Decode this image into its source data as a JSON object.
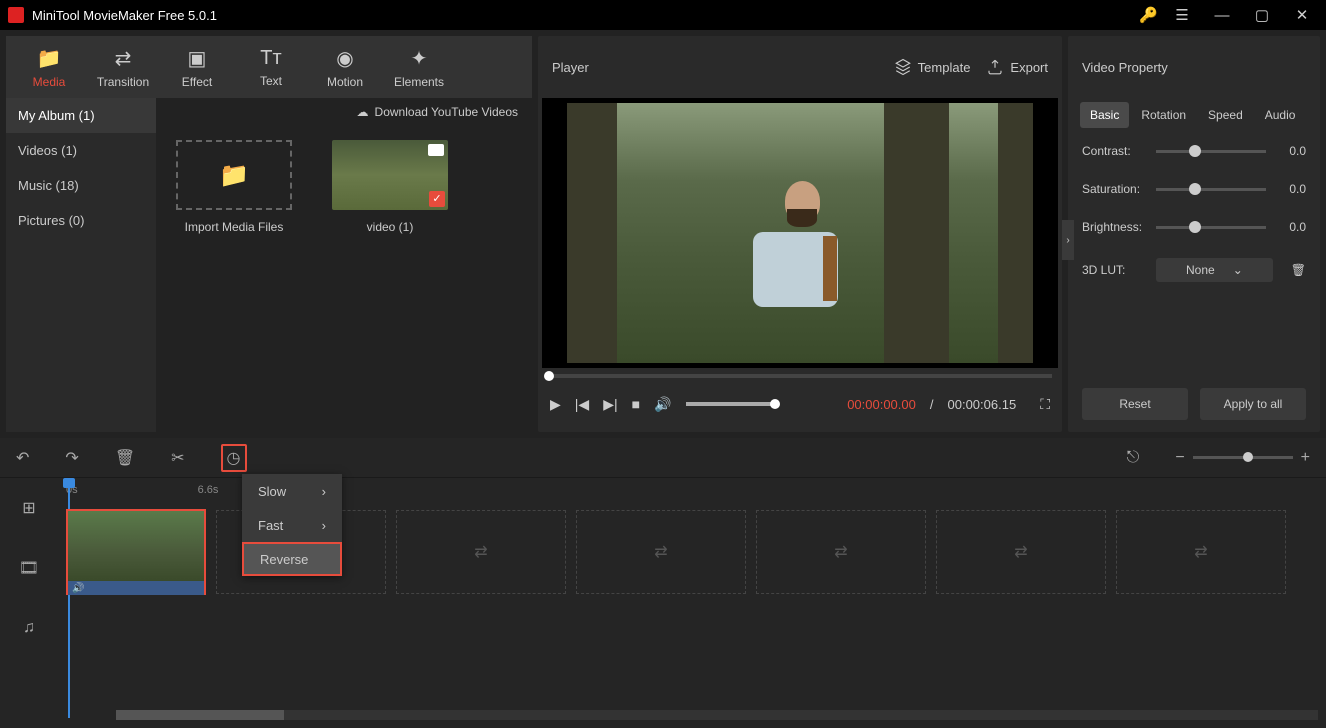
{
  "app": {
    "title": "MiniTool MovieMaker Free 5.0.1"
  },
  "toolbar_tabs": [
    {
      "label": "Media",
      "active": true
    },
    {
      "label": "Transition",
      "active": false
    },
    {
      "label": "Effect",
      "active": false
    },
    {
      "label": "Text",
      "active": false
    },
    {
      "label": "Motion",
      "active": false
    },
    {
      "label": "Elements",
      "active": false
    }
  ],
  "sidebar": {
    "items": [
      {
        "label": "My Album (1)",
        "active": true
      },
      {
        "label": "Videos (1)",
        "active": false
      },
      {
        "label": "Music (18)",
        "active": false
      },
      {
        "label": "Pictures (0)",
        "active": false
      }
    ],
    "download_label": "Download YouTube Videos",
    "import_label": "Import Media Files",
    "video_thumb_label": "video (1)"
  },
  "player": {
    "title": "Player",
    "template_label": "Template",
    "export_label": "Export",
    "time_current": "00:00:00.00",
    "time_sep": "/",
    "time_duration": "00:00:06.15"
  },
  "props": {
    "title": "Video Property",
    "tabs": [
      "Basic",
      "Rotation",
      "Speed",
      "Audio"
    ],
    "active_tab": "Basic",
    "contrast": {
      "label": "Contrast:",
      "value": "0.0"
    },
    "saturation": {
      "label": "Saturation:",
      "value": "0.0"
    },
    "brightness": {
      "label": "Brightness:",
      "value": "0.0"
    },
    "lut": {
      "label": "3D LUT:",
      "value": "None"
    },
    "reset": "Reset",
    "apply": "Apply to all"
  },
  "timeline": {
    "ruler": [
      "0s",
      "6.6s"
    ],
    "speed_menu": [
      "Slow",
      "Fast",
      "Reverse"
    ],
    "highlighted_menu": "Reverse"
  }
}
